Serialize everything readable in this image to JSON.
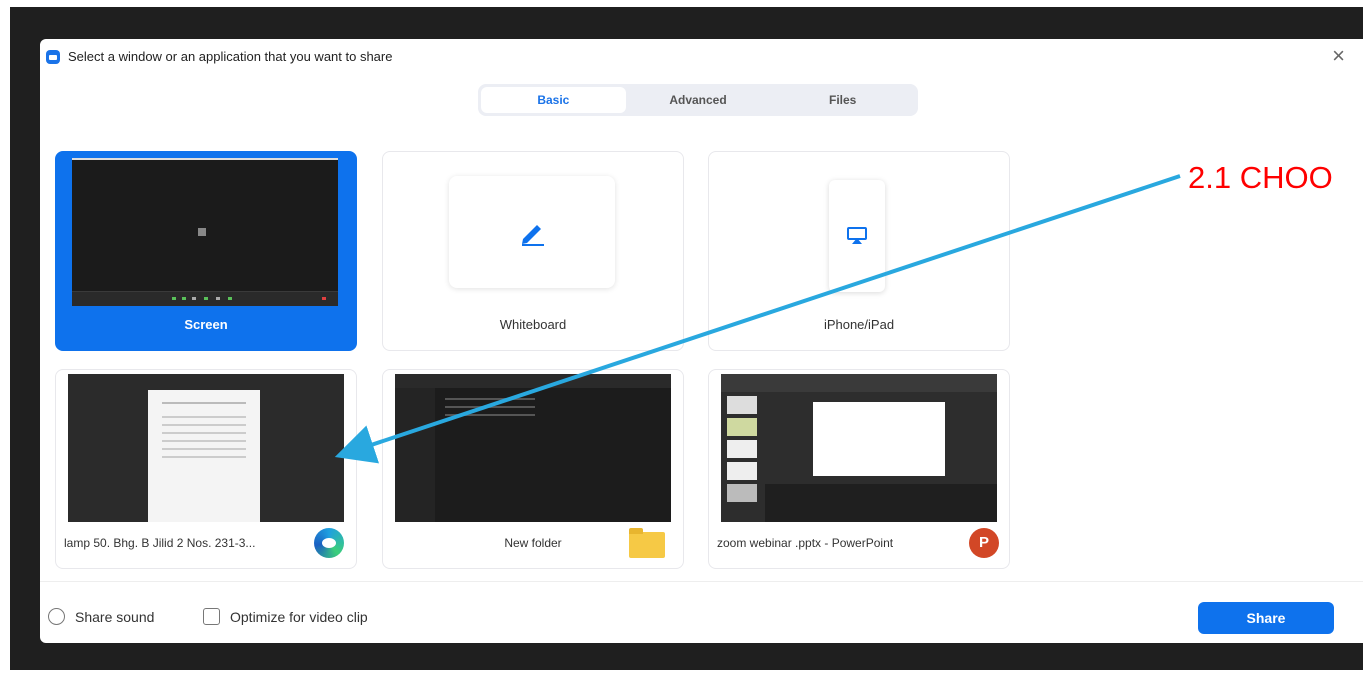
{
  "dialog": {
    "title": "Select a window or an application that you want to share",
    "close_glyph": "×"
  },
  "tabs": [
    {
      "label": "Basic",
      "active": true
    },
    {
      "label": "Advanced",
      "active": false
    },
    {
      "label": "Files",
      "active": false
    }
  ],
  "basic_tiles": [
    {
      "label": "Screen",
      "selected": true,
      "icon": "screen-preview"
    },
    {
      "label": "Whiteboard",
      "selected": false,
      "icon": "pencil-icon"
    },
    {
      "label": "iPhone/iPad",
      "selected": false,
      "icon": "airplay-icon"
    }
  ],
  "windows": [
    {
      "label": "lamp 50. Bhg. B Jilid 2 Nos. 231-3...",
      "app_icon": "edge-icon"
    },
    {
      "label": "New folder",
      "app_icon": "folder-icon"
    },
    {
      "label": "zoom webinar .pptx - PowerPoint",
      "app_icon": "powerpoint-icon",
      "app_icon_letter": "P"
    }
  ],
  "footer": {
    "share_sound": {
      "label": "Share sound",
      "checked": false
    },
    "optimize_video": {
      "label": "Optimize for video clip",
      "checked": false
    },
    "share_button": "Share"
  },
  "annotation": {
    "text": "2.1 CHOO",
    "color": "#ff0000",
    "arrow_color": "#29a8df"
  },
  "colors": {
    "accent": "#0e72ed",
    "backdrop": "#1f1f1f"
  }
}
